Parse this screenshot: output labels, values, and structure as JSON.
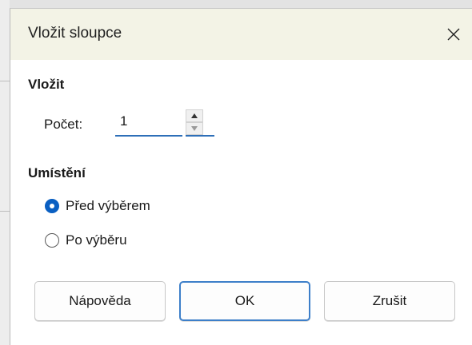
{
  "dialog": {
    "title": "Vložit sloupce",
    "close_icon": "close-icon"
  },
  "insert": {
    "heading": "Vložit",
    "count_label": "Počet:",
    "count_value": "1"
  },
  "placement": {
    "heading": "Umístění",
    "options": [
      {
        "label": "Před výběrem",
        "checked": true
      },
      {
        "label": "Po výběru",
        "checked": false
      }
    ]
  },
  "buttons": {
    "help": "Nápověda",
    "ok": "OK",
    "cancel": "Zrušit"
  },
  "colors": {
    "accent": "#0a5fc2",
    "titlebar": "#f3f3e6"
  }
}
